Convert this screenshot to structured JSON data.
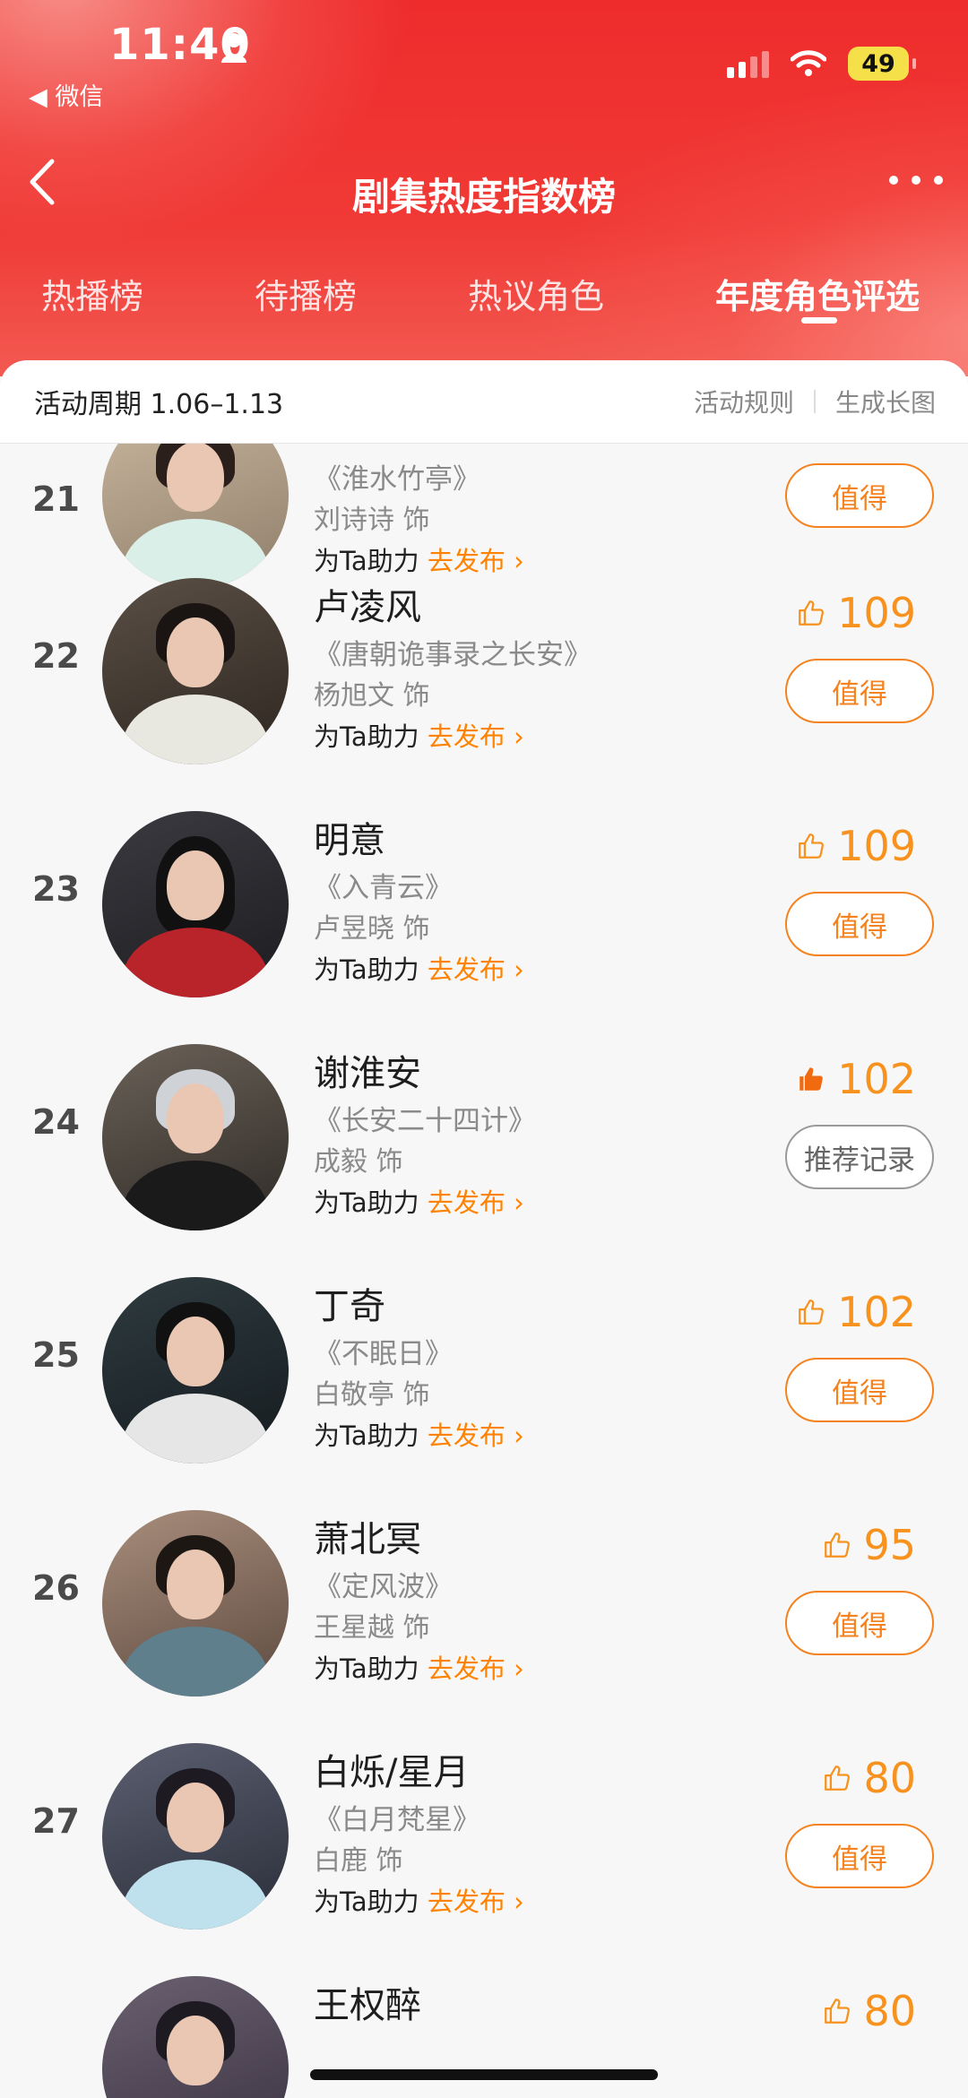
{
  "status_bar": {
    "time": "11:40",
    "back_app": "微信",
    "battery": "49"
  },
  "header": {
    "title": "剧集热度指数榜"
  },
  "tabs": [
    {
      "label": "热播榜"
    },
    {
      "label": "待播榜"
    },
    {
      "label": "热议角色"
    },
    {
      "label": "年度角色评选",
      "active": true
    }
  ],
  "period_bar": {
    "period": "活动周期 1.06–1.13",
    "rules": "活动规则",
    "long_image": "生成长图"
  },
  "list": [
    {
      "rank": "21",
      "name": "",
      "drama": "《淮水竹亭》",
      "actor": "刘诗诗 饰",
      "boost": "为Ta助力",
      "boost_link": "去发布 ›",
      "likes": "",
      "button": "值得",
      "liked": false
    },
    {
      "rank": "22",
      "name": "卢凌风",
      "drama": "《唐朝诡事录之长安》",
      "actor": "杨旭文 饰",
      "boost": "为Ta助力",
      "boost_link": "去发布 ›",
      "likes": "109",
      "button": "值得",
      "liked": false
    },
    {
      "rank": "23",
      "name": "明意",
      "drama": "《入青云》",
      "actor": "卢昱晓 饰",
      "boost": "为Ta助力",
      "boost_link": "去发布 ›",
      "likes": "109",
      "button": "值得",
      "liked": false
    },
    {
      "rank": "24",
      "name": "谢淮安",
      "drama": "《长安二十四计》",
      "actor": "成毅 饰",
      "boost": "为Ta助力",
      "boost_link": "去发布 ›",
      "likes": "102",
      "button": "推荐记录",
      "liked": true
    },
    {
      "rank": "25",
      "name": "丁奇",
      "drama": "《不眠日》",
      "actor": "白敬亭 饰",
      "boost": "为Ta助力",
      "boost_link": "去发布 ›",
      "likes": "102",
      "button": "值得",
      "liked": false
    },
    {
      "rank": "26",
      "name": "萧北冥",
      "drama": "《定风波》",
      "actor": "王星越 饰",
      "boost": "为Ta助力",
      "boost_link": "去发布 ›",
      "likes": "95",
      "button": "值得",
      "liked": false
    },
    {
      "rank": "27",
      "name": "白烁/星月",
      "drama": "《白月梵星》",
      "actor": "白鹿 饰",
      "boost": "为Ta助力",
      "boost_link": "去发布 ›",
      "likes": "80",
      "button": "值得",
      "liked": false
    },
    {
      "rank": "",
      "name": "王权醉",
      "drama": "",
      "actor": "",
      "boost": "",
      "boost_link": "",
      "likes": "80",
      "button": "",
      "liked": false
    }
  ],
  "colors": {
    "header_red": "#ee2c2c",
    "accent_orange": "#f5821f",
    "like_orange": "#f7921e",
    "link_orange": "#ff8200"
  }
}
